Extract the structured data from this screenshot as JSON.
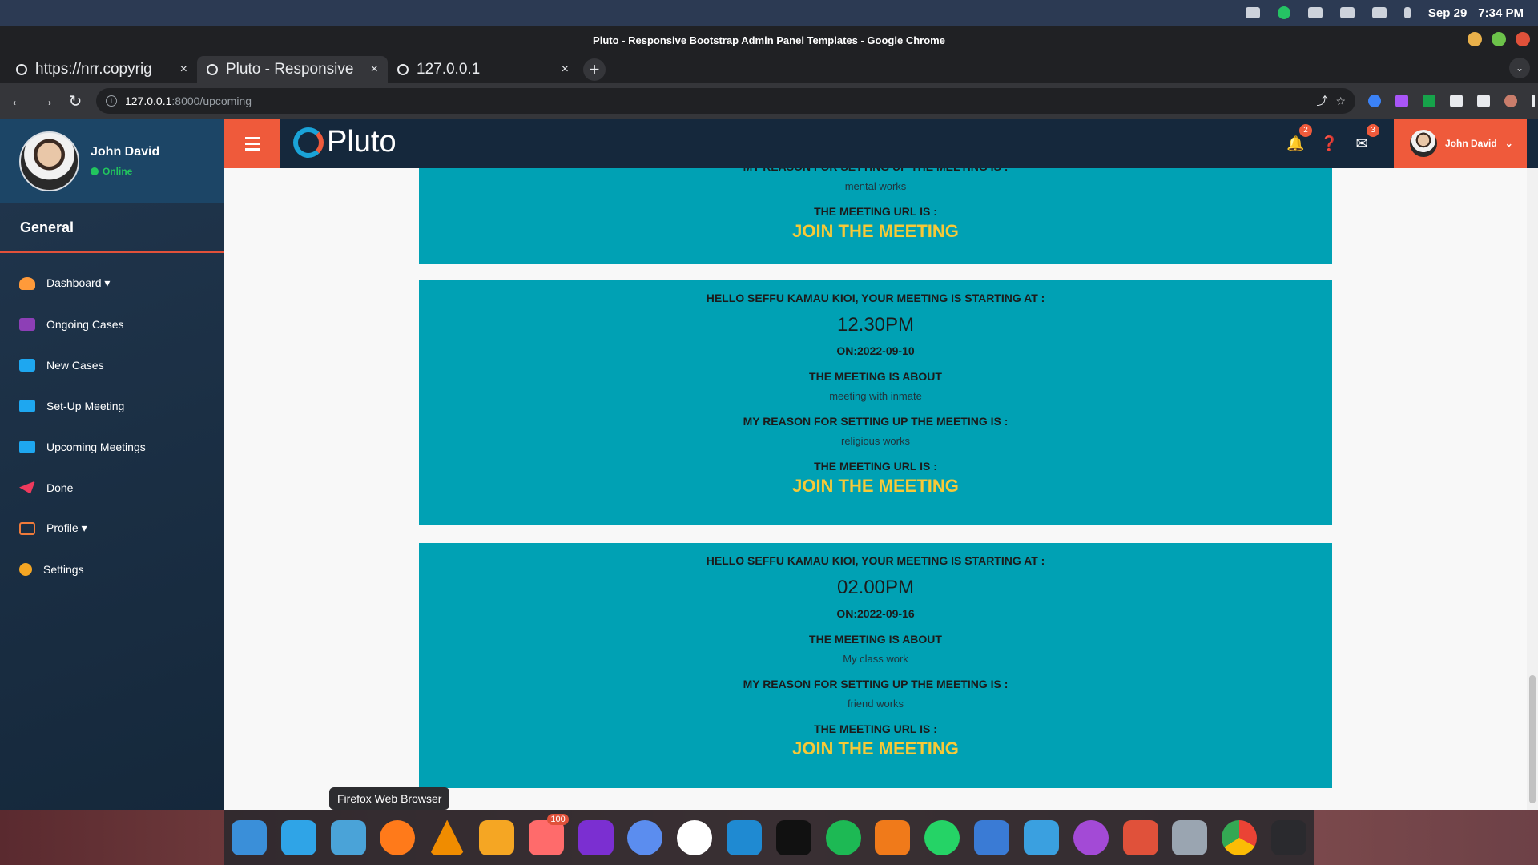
{
  "system": {
    "date": "Sep 29",
    "time": "7:34 PM"
  },
  "window": {
    "title": "Pluto - Responsive Bootstrap Admin Panel Templates - Google Chrome"
  },
  "tabs": [
    {
      "label": "https://nrr.copyrig",
      "close": "×"
    },
    {
      "label": "Pluto - Responsive",
      "close": "×"
    },
    {
      "label": "127.0.0.1",
      "close": "×"
    }
  ],
  "address": {
    "host": "127.0.0.1",
    "path": ":8000/upcoming"
  },
  "sidebar": {
    "user_name": "John David",
    "status": "Online",
    "section": "General",
    "items": [
      {
        "label": "Dashboard ▾",
        "icon": "dashboard-icon",
        "color": "#ff9a3a"
      },
      {
        "label": "Ongoing Cases",
        "icon": "table-icon",
        "color": "#8d3fb6"
      },
      {
        "label": "New Cases",
        "icon": "briefcase-icon",
        "color": "#1ea7f0"
      },
      {
        "label": "Set-Up Meeting",
        "icon": "briefcase-icon",
        "color": "#1ea7f0"
      },
      {
        "label": "Upcoming Meetings",
        "icon": "briefcase-icon",
        "color": "#1ea7f0"
      },
      {
        "label": "Done",
        "icon": "paper-plane-icon",
        "color": "#ef3a5d"
      },
      {
        "label": "Profile ▾",
        "icon": "clone-icon",
        "color": "#ef7a3a"
      },
      {
        "label": "Settings",
        "icon": "gear-icon",
        "color": "#f5a623"
      }
    ]
  },
  "header": {
    "logo": "Pluto",
    "notifications_count": "2",
    "messages_count": "3",
    "user_name": "John David"
  },
  "labels": {
    "about": "THE MEETING IS ABOUT",
    "reason": "MY REASON FOR SETTING UP THE MEETING IS :",
    "url": "THE MEETING URL IS :",
    "join": "JOIN THE MEETING"
  },
  "meetings": [
    {
      "reason": "mental works"
    },
    {
      "greeting": "HELLO SEFFU KAMAU KIOI, YOUR MEETING IS STARTING AT :",
      "time": "12.30PM",
      "date": "ON:2022-09-10",
      "about": "meeting with inmate",
      "reason": "religious works"
    },
    {
      "greeting": "HELLO SEFFU KAMAU KIOI, YOUR MEETING IS STARTING AT :",
      "time": "02.00PM",
      "date": "ON:2022-09-16",
      "about": "My class work",
      "reason": "friend works"
    }
  ],
  "dock": {
    "tooltip": "Firefox Web Browser",
    "badge": "100"
  },
  "colors": {
    "accent": "#ef5a3b",
    "card": "#00a1b4",
    "link": "#f7c937",
    "sidebar": "#1a2e43"
  }
}
